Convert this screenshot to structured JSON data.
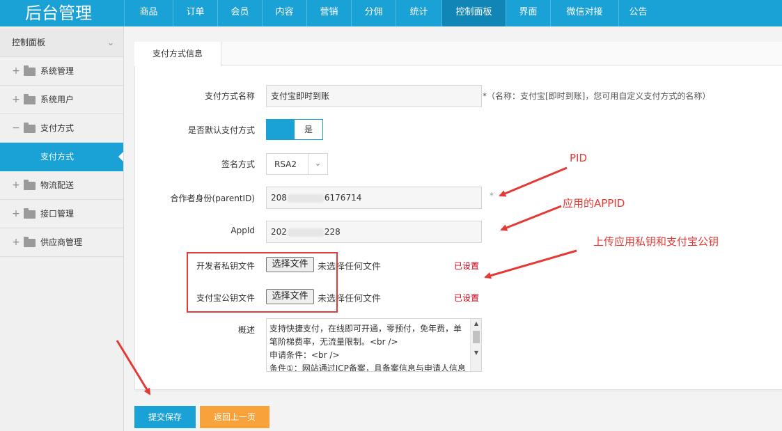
{
  "brand": "后台管理",
  "nav": [
    "商品",
    "订单",
    "会员",
    "内容",
    "营销",
    "分佣",
    "统计",
    "控制面板",
    "界面",
    "微信对接",
    "公告"
  ],
  "sidebar": {
    "header": "控制面板",
    "items": [
      {
        "label": "系统管理",
        "sign": "+"
      },
      {
        "label": "系统用户",
        "sign": "+"
      },
      {
        "label": "支付方式",
        "sign": "−"
      },
      {
        "label": "支付方式",
        "active": true
      },
      {
        "label": "物流配送",
        "sign": "+"
      },
      {
        "label": "接口管理",
        "sign": "+"
      },
      {
        "label": "供应商管理",
        "sign": "+"
      }
    ]
  },
  "tab": "支付方式信息",
  "form": {
    "name_label": "支付方式名称",
    "name_value": "支付宝即时到账",
    "name_hint": "*（名称：支付宝[即时到账]，您可用自定义支付方式的名称）",
    "default_label": "是否默认支付方式",
    "default_value": "是",
    "sign_label": "签名方式",
    "sign_value": "RSA2",
    "pid_label": "合作者身份(parentID)",
    "pid_prefix": "208",
    "pid_suffix": "6176714",
    "pid_star": "*",
    "appid_label": "AppId",
    "appid_prefix": "202",
    "appid_suffix": "228",
    "private_key_label": "开发者私钥文件",
    "public_key_label": "支付宝公钥文件",
    "choose_file": "选择文件",
    "no_file": "未选择任何文件",
    "private_key_status": "已设置",
    "public_key_status": "已设置",
    "desc_label": "概述",
    "desc_lines": [
      "支持快捷支付，在线即可开通，零预付，免年费，单",
      "笔阶梯费率，无流量限制。<br />",
      "申请条件：<br />",
      "条件①：网站通过ICP备案，且备案信息与申请人信息"
    ]
  },
  "buttons": {
    "save": "提交保存",
    "back": "返回上一页"
  },
  "annotations": {
    "pid": "PID",
    "appid": "应用的APPID",
    "keys": "上传应用私钥和支付宝公钥"
  },
  "colors": {
    "primary": "#1aa1d6",
    "warning": "#f7a23a",
    "annotation_red": "#e53935"
  }
}
